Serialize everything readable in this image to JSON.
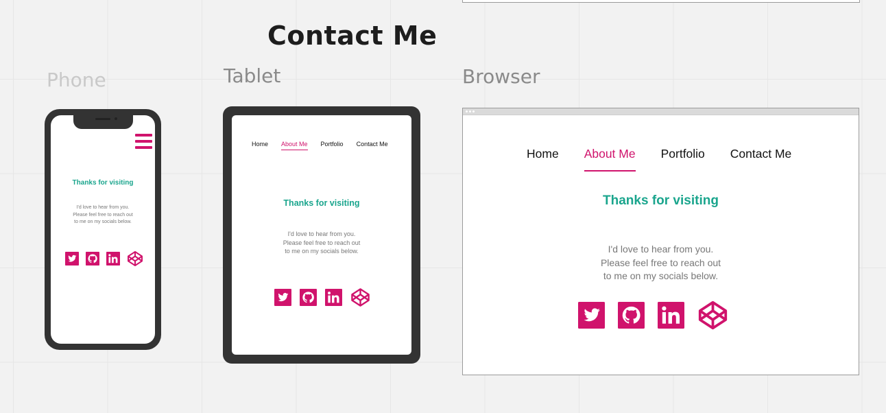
{
  "page": {
    "title": "Contact Me"
  },
  "labels": {
    "phone": "Phone",
    "tablet": "Tablet",
    "browser": "Browser"
  },
  "nav": {
    "home": "Home",
    "about": "About Me",
    "portfolio": "Portfolio",
    "contact": "Contact Me",
    "active": "About Me"
  },
  "content": {
    "thanks": "Thanks for visiting",
    "line1": "I'd love to hear from you.",
    "line2": "Please feel free to reach out",
    "line3": "to me on my socials below."
  },
  "socials": [
    "twitter-icon",
    "github-icon",
    "linkedin-icon",
    "codepen-icon"
  ],
  "colors": {
    "accent": "#d0136c",
    "heading_green": "#1aa58d",
    "device_frame": "#333333",
    "canvas": "#f2f2f2"
  }
}
